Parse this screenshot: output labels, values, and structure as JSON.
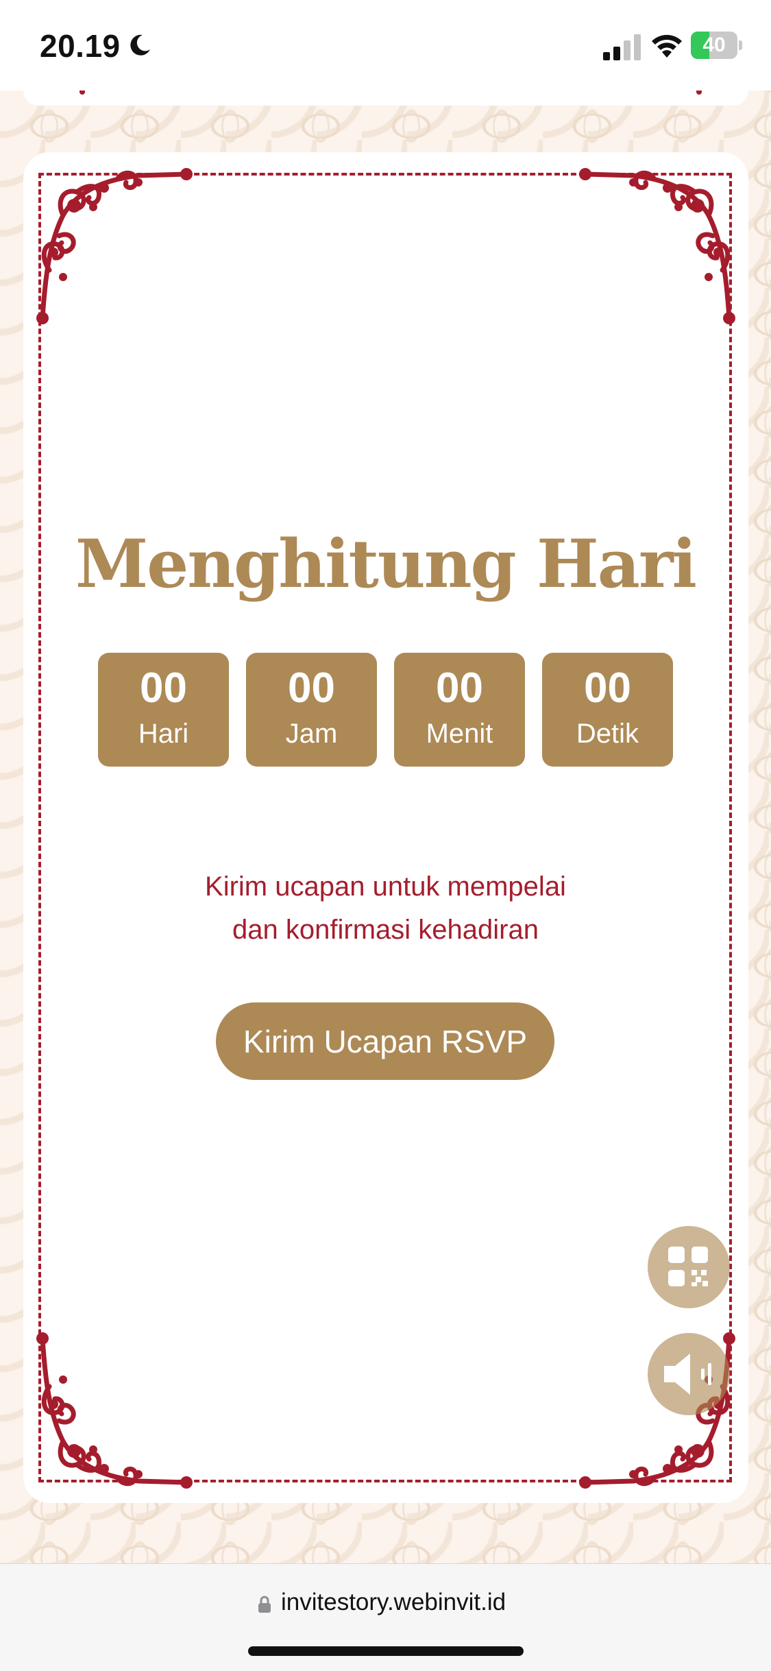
{
  "status_bar": {
    "time": "20.19",
    "battery": "40",
    "battery_level": 0.4,
    "icons": [
      "moon-icon",
      "signal-icon",
      "wifi-icon",
      "battery-charging-icon"
    ]
  },
  "countdown": {
    "title": "Menghitung Hari",
    "units": [
      {
        "value": "00",
        "label": "Hari"
      },
      {
        "value": "00",
        "label": "Jam"
      },
      {
        "value": "00",
        "label": "Menit"
      },
      {
        "value": "00",
        "label": "Detik"
      }
    ]
  },
  "rsvp": {
    "message_line1": "Kirim ucapan untuk mempelai",
    "message_line2": "dan konfirmasi kehadiran",
    "button_label": "Kirim Ucapan RSVP"
  },
  "floating_buttons": [
    "qr-code-icon",
    "speaker-icon"
  ],
  "browser": {
    "url": "invitestory.webinvit.id"
  },
  "colors": {
    "gold": "#ad8956",
    "crimson": "#a51d2d",
    "pattern_bg": "#fbf3ec"
  }
}
